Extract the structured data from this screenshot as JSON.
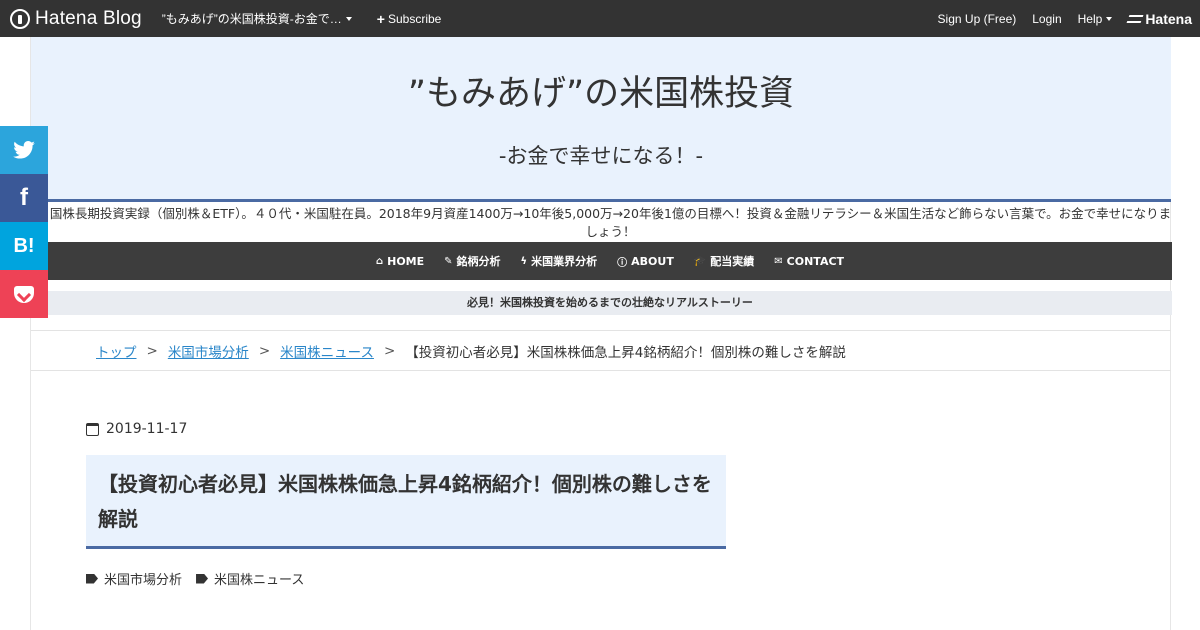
{
  "topbar": {
    "logo": "Hatena Blog",
    "blog_name": "”もみあげ”の米国株投資-お金で…",
    "subscribe": "Subscribe",
    "signup": "Sign Up (Free)",
    "login": "Login",
    "help": "Help",
    "hatena": "Hatena"
  },
  "header": {
    "title": "”もみあげ”の米国株投資",
    "subtitle": "-お金で幸せになる！-",
    "description": "国株長期投資実録（個別株＆ETF）。４０代・米国駐在員。2018年9月資産1400万→10年後5,000万→20年後1億の目標へ！投資＆金融リテラシー＆米国生活など飾らない言葉で。お金で幸せになりましょう！"
  },
  "nav": {
    "items": [
      {
        "icon": "home-icon",
        "glyph": "⌂",
        "label": "HOME"
      },
      {
        "icon": "wrench-icon",
        "glyph": "✎",
        "label": "銘柄分析"
      },
      {
        "icon": "bolt-icon",
        "glyph": "ϟ",
        "label": "米国業界分析"
      },
      {
        "icon": "info-icon",
        "glyph": "ⓘ",
        "label": "ABOUT"
      },
      {
        "icon": "graduation-cap-icon",
        "glyph": "🎓",
        "label": "配当実績"
      },
      {
        "icon": "envelope-icon",
        "glyph": "✉",
        "label": "CONTACT"
      }
    ]
  },
  "notice": "必見！米国株投資を始めるまでの壮絶なリアルストーリー",
  "breadcrumb": {
    "items": [
      "トップ",
      "米国市場分析",
      "米国株ニュース"
    ],
    "separator": ">",
    "current": "【投資初心者必見】米国株株価急上昇4銘柄紹介！個別株の難しさを解説"
  },
  "entry": {
    "date": "2019-11-17",
    "title": "【投資初心者必見】米国株株価急上昇4銘柄紹介！個別株の難しさを解説",
    "tags": [
      "米国市場分析",
      "米国株ニュース"
    ]
  },
  "share": {
    "twitter": "twitter-icon",
    "facebook": "f",
    "hatebu": "B!",
    "pocket": "pocket-icon"
  },
  "colors": {
    "topbar": "#333333",
    "header_bg": "#e9f2fd",
    "accent_border": "#4a6aa3",
    "nav_bg": "#3d3d3d",
    "link": "#2a86c9"
  }
}
